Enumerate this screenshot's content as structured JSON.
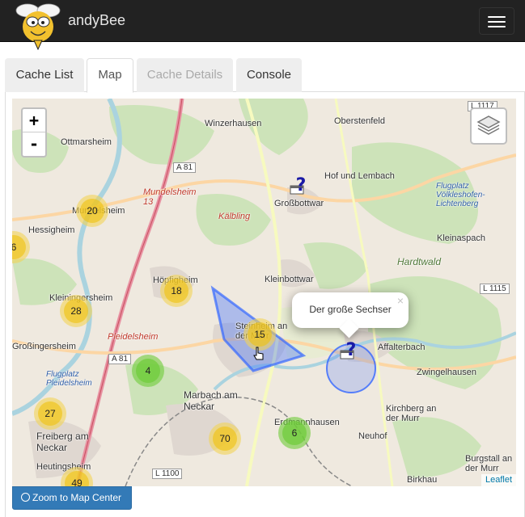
{
  "app": {
    "name": "andyBee",
    "colors": {
      "navbar": "#222222",
      "primary": "#337ab7"
    }
  },
  "tabs": [
    {
      "label": "Cache List",
      "state": "normal"
    },
    {
      "label": "Map",
      "state": "active"
    },
    {
      "label": "Cache Details",
      "state": "disabled"
    },
    {
      "label": "Console",
      "state": "normal"
    }
  ],
  "map": {
    "zoom_in": "+",
    "zoom_out": "-",
    "attribution": "Leaflet",
    "places": [
      "Winzerhausen",
      "Oberstenfeld",
      "Ottmarsheim",
      "Hof und Lembach",
      "Großbottwar",
      "Mundelsheim",
      "Hessigheim",
      "Kleinaspach",
      "Höpfigheim",
      "Kleinbottwar",
      "Kleiningersheim",
      "Steinheim an der Murr",
      "Pleidelsheim",
      "Großingersheim",
      "Affalterbach",
      "Zwingelhausen",
      "Marbach am Neckar",
      "Erdmannhausen",
      "Freiberg am Neckar",
      "Heutingsheim",
      "Kirchberg an der Murr",
      "Neuhof",
      "Burgstall an der Murr",
      "Birkhau",
      "Flugplatz Völkleshofen-Lichtenberg",
      "Flugplatz Pleidelsheim",
      "Hardtwald",
      "Kälbling",
      "Mundelsheim 13"
    ],
    "roads": [
      "A 81",
      "A 81",
      "L 1115",
      "L 1100",
      "L 1117"
    ],
    "clusters": [
      "20",
      "18",
      "28",
      "15",
      "4",
      "27",
      "49",
      "70",
      "6",
      "6"
    ],
    "popup": {
      "text": "Der große Sechser",
      "close": "×"
    },
    "markers": [
      "unknown-cache-icon",
      "unknown-cache-icon"
    ]
  },
  "button": {
    "label": "Zoom to Map Center",
    "icon": "globe-icon"
  }
}
